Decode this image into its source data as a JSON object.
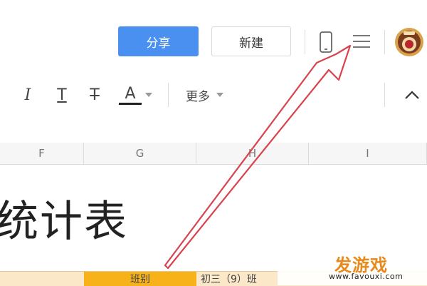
{
  "header": {
    "share_label": "分享",
    "new_label": "新建",
    "icons": [
      "phone-icon",
      "menu-icon",
      "avatar"
    ]
  },
  "toolbar": {
    "italic": "I",
    "underline": "T",
    "strikethrough": "T",
    "font_color": "A",
    "more_label": "更多",
    "collapse": "^"
  },
  "columns": [
    "F",
    "G",
    "H",
    "I"
  ],
  "sheet": {
    "title_text": "统计表",
    "row_cells": [
      "班别",
      "初三（9）班"
    ]
  },
  "watermark": {
    "brand": "发游戏",
    "url": "www.favouxi.com"
  },
  "colors": {
    "share_blue": "#4a90f0",
    "arrow_red": "#d9434e",
    "row_highlight": "#f7b21a"
  }
}
